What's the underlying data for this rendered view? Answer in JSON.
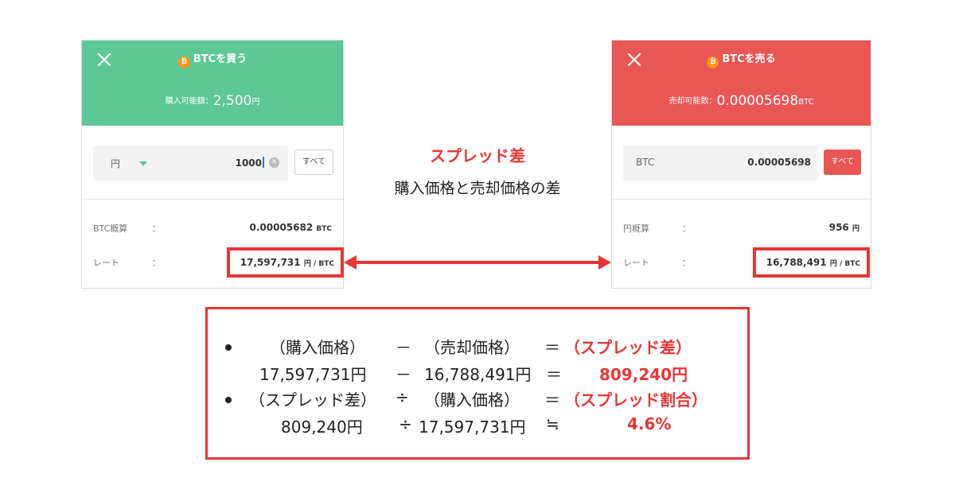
{
  "buy_panel": {
    "title": "BTCを買う",
    "available_label": "購入可能額：",
    "available_value": "2,500",
    "available_unit": "円",
    "currency": "円",
    "amount": "1000",
    "all_label": "すべて",
    "est_label": "BTC概算",
    "colon": "：",
    "est_value": "0.00005682",
    "est_unit": "BTC",
    "rate_label": "レート",
    "rate_value": "17,597,731",
    "rate_unit": "円 / BTC"
  },
  "sell_panel": {
    "title": "BTCを売る",
    "available_label": "売却可能数：",
    "available_value": "0.00005698",
    "available_unit": "BTC",
    "currency": "BTC",
    "amount": "0.00005698",
    "all_label": "すべて",
    "est_label": "円概算",
    "colon": "：",
    "est_value": "956",
    "est_unit": "円",
    "rate_label": "レート",
    "rate_value": "16,788,491",
    "rate_unit": "円 / BTC"
  },
  "center": {
    "title": "スプレッド差",
    "subtitle": "購入価格と売却価格の差"
  },
  "formula": {
    "line1": {
      "a": "（購入価格）",
      "op": "－",
      "b": "（売却価格）",
      "eq": "＝",
      "result": "（スプレッド差）"
    },
    "line2": {
      "a": "17,597,731円",
      "op": "－",
      "b": "16,788,491円",
      "eq": "＝",
      "result": "809,240円"
    },
    "line3": {
      "a": "（スプレッド差）",
      "op": "÷",
      "b": "（購入価格）",
      "eq": "＝",
      "result": "（スプレッド割合）"
    },
    "line4": {
      "a": "809,240円",
      "op": "÷",
      "b": "17,597,731円",
      "eq": "≒",
      "result": "4.6%"
    }
  },
  "colors": {
    "buy_green": "#5cc896",
    "sell_red": "#e85656",
    "accent_red": "#e83535",
    "btc_orange": "#f7931a"
  },
  "icons": {
    "close": "close-icon",
    "coin": "bitcoin-icon",
    "dropdown": "chevron-down-icon",
    "clear": "clear-icon"
  }
}
